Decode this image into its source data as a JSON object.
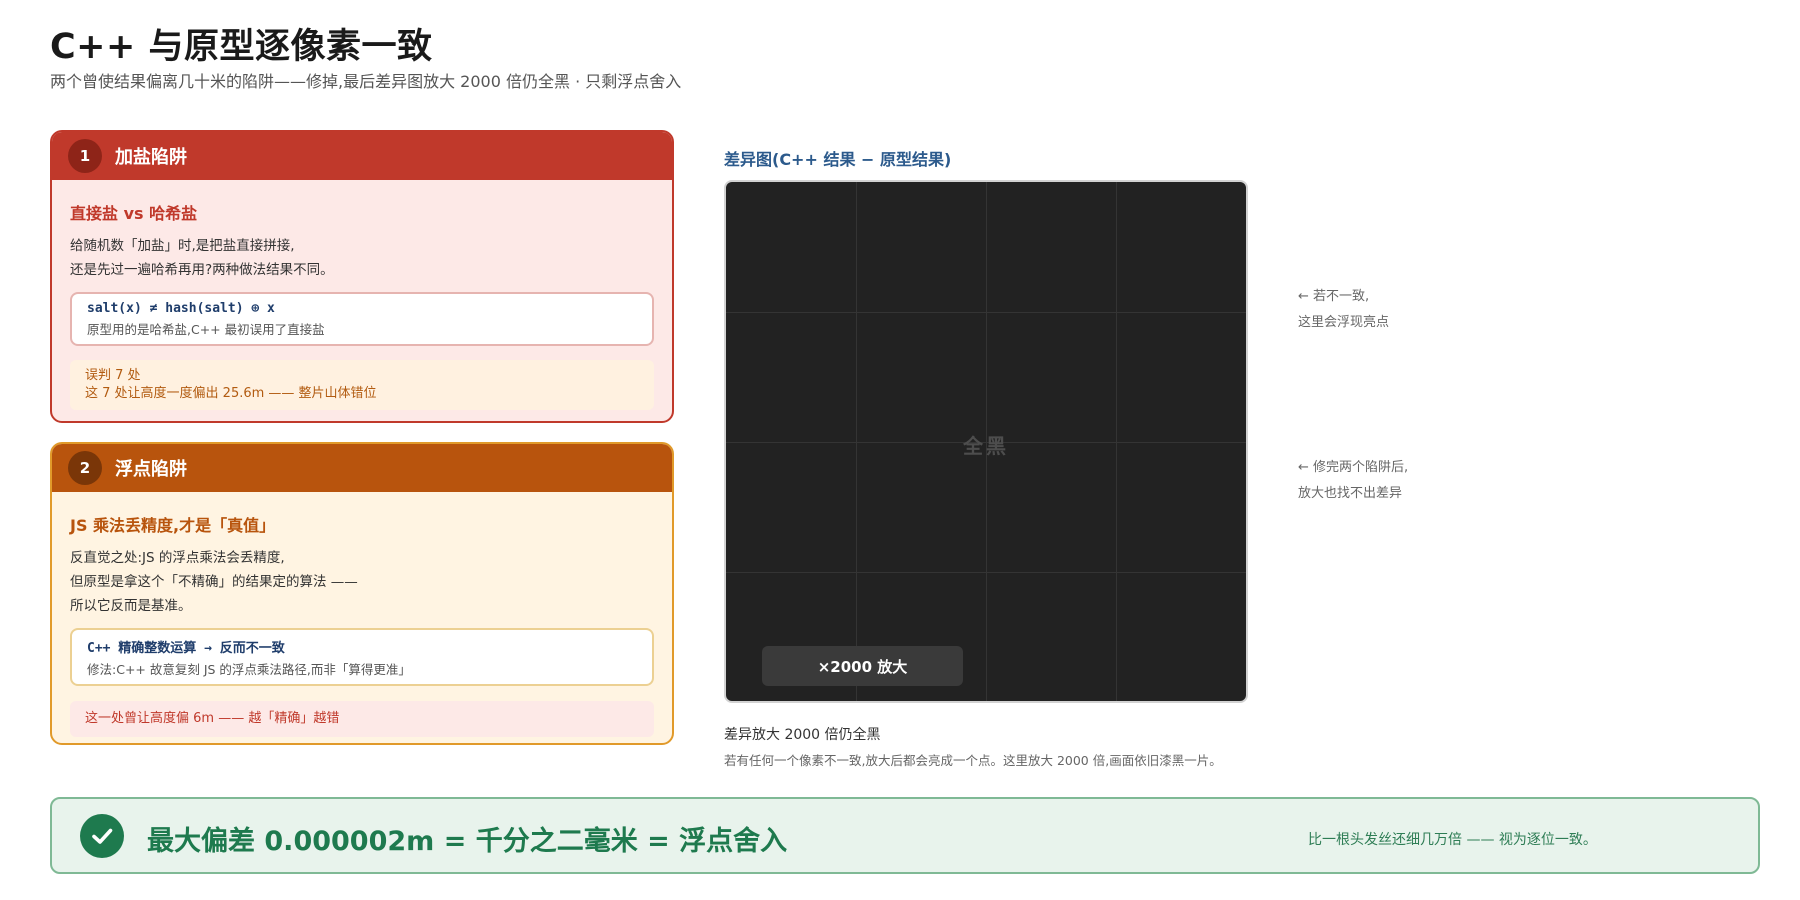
{
  "header": {
    "title": "C++ 与原型逐像素一致",
    "subtitle": "两个曾使结果偏离几十米的陷阱——修掉,最后差异图放大 2000 倍仍全黑 · 只剩浮点舍入"
  },
  "trap1": {
    "number": "1",
    "title": "加盐陷阱",
    "subhead": "直接盐 vs 哈希盐",
    "desc_lines": [
      "给随机数「加盐」时,是把盐直接拼接,",
      "还是先过一遍哈希再用?两种做法结果不同。"
    ],
    "code": "salt(x) ≠ hash(salt) ⊕ x",
    "code_note": "原型用的是哈希盐,C++ 最初误用了直接盐",
    "note_lines": [
      "误判 7 处",
      "这 7 处让高度一度偏出 25.6m —— 整片山体错位"
    ]
  },
  "trap2": {
    "number": "2",
    "title": "浮点陷阱",
    "subhead": "JS 乘法丢精度,才是「真值」",
    "desc_lines": [
      "反直觉之处:JS 的浮点乘法会丢精度,",
      "但原型是拿这个「不精确」的结果定的算法 ——",
      "所以它反而是基准。"
    ],
    "code": "C++ 精确整数运算 → 反而不一致",
    "code_note": "修法:C++ 故意复刻 JS 的浮点乘法路径,而非「算得更准」",
    "note": "这一处曾让高度偏 6m —— 越「精确」越错"
  },
  "diff": {
    "label": "差异图(C++ 结果 − 原型结果)",
    "center_text": "全黑",
    "zoom": "×2000 放大",
    "annotation1": [
      "← 若不一致,",
      "这里会浮现亮点"
    ],
    "annotation2": [
      "← 修完两个陷阱后,",
      "放大也找不出差异"
    ],
    "caption_title": "差异放大 2000 倍仍全黑",
    "caption_desc": "若有任何一个像素不一致,放大后都会亮成一个点。这里放大 2000 倍,画面依旧漆黑一片。"
  },
  "banner": {
    "text": "最大偏差 0.000002m = 千分之二毫米 = 浮点舍入",
    "right": "比一根头发丝还细几万倍 —— 视为逐位一致。"
  },
  "colors": {
    "trap1_accent": "#c0392b",
    "trap2_accent": "#b8540d",
    "diff_background": "#222222",
    "success": "#1e7a4e",
    "label_blue": "#2c5a8c"
  },
  "icons": {
    "banner": "check-icon"
  }
}
